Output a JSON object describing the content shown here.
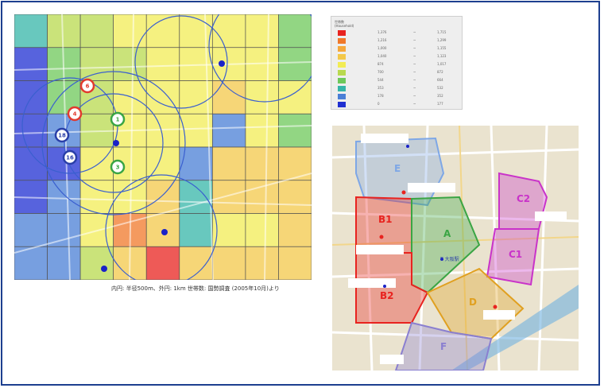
{
  "left_map": {
    "caption": "内円: 半径500m、外円: 1km  世帯数: 国勢調査 (2005年10月)より",
    "pins": [
      {
        "label": "6",
        "color": "#e23b2e"
      },
      {
        "label": "4",
        "color": "#e23b2e"
      },
      {
        "label": "1",
        "color": "#3aa544"
      },
      {
        "label": "3",
        "color": "#3aa544"
      },
      {
        "label": "18",
        "color": "#2a3fa8"
      },
      {
        "label": "16",
        "color": "#2a3fa8"
      }
    ]
  },
  "legend": {
    "title_line1": "世帯数",
    "title_line2": "(Household)",
    "rows": [
      {
        "color": "#e8231f",
        "low": "1,376",
        "sep": "~",
        "high": "1,715"
      },
      {
        "color": "#f0782a",
        "low": "1,216",
        "sep": "~",
        "high": "1,299"
      },
      {
        "color": "#f5a83c",
        "low": "1,000",
        "sep": "~",
        "high": "1,155"
      },
      {
        "color": "#f3c84a",
        "low": "1,040",
        "sep": "~",
        "high": "1,123"
      },
      {
        "color": "#f2ec55",
        "low": "874",
        "sep": "~",
        "high": "1,017"
      },
      {
        "color": "#b8d94e",
        "low": "700",
        "sep": "~",
        "high": "872"
      },
      {
        "color": "#6ec85a",
        "low": "544",
        "sep": "~",
        "high": "664"
      },
      {
        "color": "#35b5a8",
        "low": "353",
        "sep": "~",
        "high": "532"
      },
      {
        "color": "#4a7fd6",
        "low": "178",
        "sep": "~",
        "high": "352"
      },
      {
        "color": "#1f2fd1",
        "low": "0",
        "sep": "~",
        "high": "177"
      }
    ]
  },
  "right_map": {
    "zones": [
      {
        "label": "E",
        "color": "#7ea7e6"
      },
      {
        "label": "B1",
        "color": "#e8231f"
      },
      {
        "label": "A",
        "color": "#3aa544"
      },
      {
        "label": "C2",
        "color": "#c933c9"
      },
      {
        "label": "C1",
        "color": "#c933c9"
      },
      {
        "label": "B2",
        "color": "#e8231f"
      },
      {
        "label": "D",
        "color": "#e0a020"
      },
      {
        "label": "F",
        "color": "#8a7fd0"
      }
    ],
    "marker_label": "T 大阪駅"
  }
}
